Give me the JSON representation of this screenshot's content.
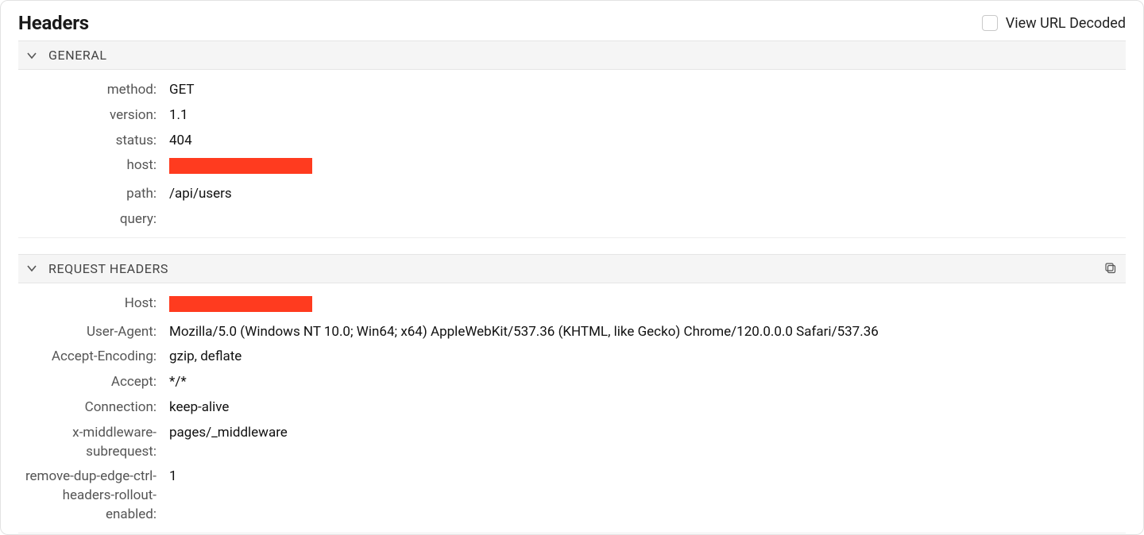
{
  "panel": {
    "title": "Headers",
    "view_url_decoded_label": "View URL Decoded"
  },
  "sections": {
    "general": {
      "title": "GENERAL",
      "fields": {
        "method_label": "method",
        "method_value": "GET",
        "version_label": "version",
        "version_value": "1.1",
        "status_label": "status",
        "status_value": "404",
        "host_label": "host",
        "host_redacted": true,
        "path_label": "path",
        "path_value": "/api/users",
        "query_label": "query",
        "query_value": ""
      }
    },
    "request_headers": {
      "title": "REQUEST HEADERS",
      "fields": {
        "host_label": "Host",
        "host_redacted": true,
        "user_agent_label": "User-Agent",
        "user_agent_value": "Mozilla/5.0 (Windows NT 10.0; Win64; x64) AppleWebKit/537.36 (KHTML, like Gecko) Chrome/120.0.0.0 Safari/537.36",
        "accept_encoding_label": "Accept-Encoding",
        "accept_encoding_value": "gzip, deflate",
        "accept_label": "Accept",
        "accept_value": "*/*",
        "connection_label": "Connection",
        "connection_value": "keep-alive",
        "x_middleware_subrequest_label": "x-middleware-subrequest",
        "x_middleware_subrequest_value": "pages/_middleware",
        "remove_dup_label": "remove-dup-edge-ctrl-headers-rollout-enabled",
        "remove_dup_value": "1"
      }
    }
  }
}
